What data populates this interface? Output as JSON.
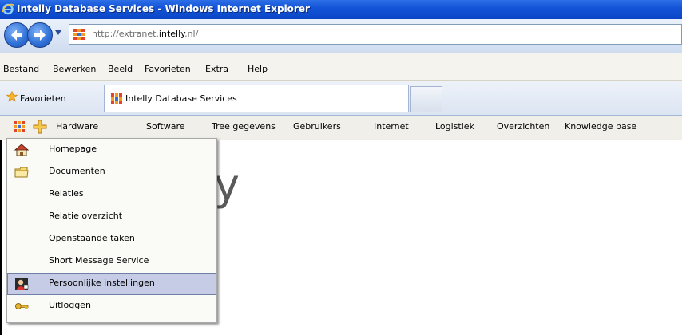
{
  "window": {
    "title": "Intelly Database Services - Windows Internet Explorer"
  },
  "address_bar": {
    "url_prefix": "http://extranet.",
    "url_domain": "intelly",
    "url_suffix": ".nl/"
  },
  "menubar": {
    "items": [
      "Bestand",
      "Bewerken",
      "Beeld",
      "Favorieten",
      "Extra",
      "Help"
    ]
  },
  "favorites_bar": {
    "label": "Favorieten",
    "active_tab": "Intelly Database Services"
  },
  "site_nav": {
    "items": [
      "Hardware",
      "Software",
      "Tree gegevens",
      "Gebruikers",
      "Internet",
      "Logistiek",
      "Overzichten",
      "Knowledge base"
    ]
  },
  "page": {
    "logo_text": "lly"
  },
  "dropdown": {
    "items": [
      {
        "label": "Homepage",
        "icon": "home-icon",
        "selected": false
      },
      {
        "label": "Documenten",
        "icon": "folder-icon",
        "selected": false
      },
      {
        "label": "Relaties",
        "icon": "",
        "selected": false
      },
      {
        "label": "Relatie overzicht",
        "icon": "",
        "selected": false
      },
      {
        "label": "Openstaande taken",
        "icon": "",
        "selected": false
      },
      {
        "label": "Short Message Service",
        "icon": "",
        "selected": false
      },
      {
        "label": "Persoonlijke instellingen",
        "icon": "user-settings-icon",
        "selected": true
      },
      {
        "label": "Uitloggen",
        "icon": "key-icon",
        "selected": false
      }
    ]
  },
  "colors": {
    "titlebar": "#1454d8",
    "selection": "#c6cce6",
    "menu_bg": "#fafaf7"
  }
}
